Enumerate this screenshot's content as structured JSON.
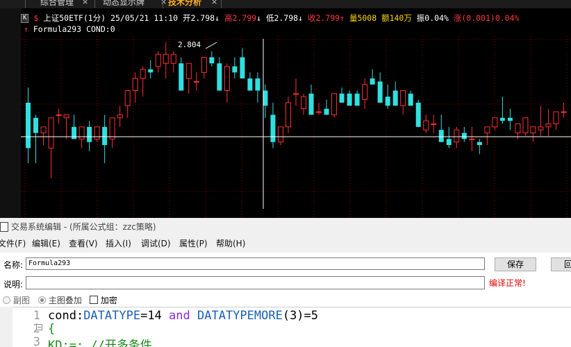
{
  "tabs": [
    {
      "label": "综合管理"
    },
    {
      "label": "动态显示牌"
    },
    {
      "label": "技术分析"
    }
  ],
  "quote_header": {
    "k_badge": "K",
    "dollar": "$",
    "symbol": "上证50ETF(1分)",
    "datetime": "25/05/21 11:10",
    "open_label": "开",
    "open_value": "2.798",
    "high_label": "高",
    "high_value": "2.799",
    "low_label": "低",
    "low_value": "2.798",
    "close_label": "收",
    "close_value": "2.799",
    "volume_label": "量",
    "volume_value": "5008",
    "amount_label": "额",
    "amount_value": "140万",
    "amplitude_label": "振",
    "amplitude_value": "0.04%",
    "change_label": "涨",
    "change_value": "(0.001)",
    "change_pct": "0.04%"
  },
  "formula_header": {
    "name": "Formula293",
    "cond_label": "COND:",
    "cond_value": "0"
  },
  "chart_annotation": "2.804",
  "chart_data": {
    "type": "candlestick",
    "title": "上证50ETF(1分)",
    "colors": {
      "up": "#ff3030",
      "down": "#30e0e0",
      "crosshair": "#ffffff",
      "grid": "#8b0000"
    },
    "candles": [
      {
        "o": 2.797,
        "h": 2.7975,
        "l": 2.795,
        "c": 2.7955
      },
      {
        "o": 2.7965,
        "h": 2.7966,
        "l": 2.795,
        "c": 2.796
      },
      {
        "o": 2.796,
        "h": 2.7962,
        "l": 2.7956,
        "c": 2.7962
      },
      {
        "o": 2.7955,
        "h": 2.7965,
        "l": 2.7945,
        "c": 2.7965
      },
      {
        "o": 2.7966,
        "h": 2.7968,
        "l": 2.7963,
        "c": 2.7966
      },
      {
        "o": 2.7965,
        "h": 2.7966,
        "l": 2.7958,
        "c": 2.7966
      },
      {
        "o": 2.7962,
        "h": 2.7966,
        "l": 2.7958,
        "c": 2.7958
      },
      {
        "o": 2.7958,
        "h": 2.7962,
        "l": 2.7955,
        "c": 2.7962
      },
      {
        "o": 2.7962,
        "h": 2.7964,
        "l": 2.7954,
        "c": 2.7957
      },
      {
        "o": 2.7958,
        "h": 2.7962,
        "l": 2.7957,
        "c": 2.7962
      },
      {
        "o": 2.7962,
        "h": 2.7966,
        "l": 2.795,
        "c": 2.7956
      },
      {
        "o": 2.7958,
        "h": 2.7965,
        "l": 2.7955,
        "c": 2.7965
      },
      {
        "o": 2.7965,
        "h": 2.7969,
        "l": 2.7962,
        "c": 2.7966
      },
      {
        "o": 2.7969,
        "h": 2.7974,
        "l": 2.7965,
        "c": 2.7974
      },
      {
        "o": 2.7974,
        "h": 2.798,
        "l": 2.797,
        "c": 2.7978
      },
      {
        "o": 2.7978,
        "h": 2.7982,
        "l": 2.7972,
        "c": 2.7981
      },
      {
        "o": 2.7981,
        "h": 2.7984,
        "l": 2.7978,
        "c": 2.798
      },
      {
        "o": 2.7982,
        "h": 2.7987,
        "l": 2.798,
        "c": 2.7986
      },
      {
        "o": 2.7983,
        "h": 2.799,
        "l": 2.7978,
        "c": 2.7986
      },
      {
        "o": 2.7983,
        "h": 2.7987,
        "l": 2.798,
        "c": 2.7986
      },
      {
        "o": 2.7983,
        "h": 2.7985,
        "l": 2.7974,
        "c": 2.7974
      },
      {
        "o": 2.7978,
        "h": 2.7983,
        "l": 2.7973,
        "c": 2.7983
      },
      {
        "o": 2.7977,
        "h": 2.798,
        "l": 2.7974,
        "c": 2.7977
      },
      {
        "o": 2.798,
        "h": 2.7985,
        "l": 2.7978,
        "c": 2.7985
      },
      {
        "o": 2.7985,
        "h": 2.7987,
        "l": 2.7982,
        "c": 2.7983
      },
      {
        "o": 2.7983,
        "h": 2.7985,
        "l": 2.7974,
        "c": 2.7974
      },
      {
        "o": 2.7974,
        "h": 2.7983,
        "l": 2.797,
        "c": 2.7982
      },
      {
        "o": 2.7982,
        "h": 2.7985,
        "l": 2.7978,
        "c": 2.798
      },
      {
        "o": 2.7985,
        "h": 2.7988,
        "l": 2.7978,
        "c": 2.7978
      },
      {
        "o": 2.7978,
        "h": 2.798,
        "l": 2.7974,
        "c": 2.7974
      },
      {
        "o": 2.7978,
        "h": 2.798,
        "l": 2.797,
        "c": 2.7974
      },
      {
        "o": 2.7974,
        "h": 2.7976,
        "l": 2.7965,
        "c": 2.7969
      },
      {
        "o": 2.7966,
        "h": 2.797,
        "l": 2.7955,
        "c": 2.7957
      },
      {
        "o": 2.7957,
        "h": 2.7962,
        "l": 2.7956,
        "c": 2.7962
      },
      {
        "o": 2.7962,
        "h": 2.7972,
        "l": 2.796,
        "c": 2.797
      },
      {
        "o": 2.7973,
        "h": 2.7978,
        "l": 2.7969,
        "c": 2.7973
      },
      {
        "o": 2.7968,
        "h": 2.7973,
        "l": 2.7966,
        "c": 2.7972
      },
      {
        "o": 2.7973,
        "h": 2.7976,
        "l": 2.7966,
        "c": 2.7966
      },
      {
        "o": 2.7967,
        "h": 2.797,
        "l": 2.7966,
        "c": 2.7967
      },
      {
        "o": 2.7968,
        "h": 2.7971,
        "l": 2.7966,
        "c": 2.7966
      },
      {
        "o": 2.7966,
        "h": 2.7973,
        "l": 2.7965,
        "c": 2.7973
      },
      {
        "o": 2.7973,
        "h": 2.7975,
        "l": 2.797,
        "c": 2.797
      },
      {
        "o": 2.7973,
        "h": 2.7974,
        "l": 2.7969,
        "c": 2.7969
      },
      {
        "o": 2.7973,
        "h": 2.7974,
        "l": 2.7969,
        "c": 2.7969
      },
      {
        "o": 2.7971,
        "h": 2.7978,
        "l": 2.7968,
        "c": 2.7976
      },
      {
        "o": 2.7978,
        "h": 2.7981,
        "l": 2.7976,
        "c": 2.7976
      },
      {
        "o": 2.7977,
        "h": 2.798,
        "l": 2.797,
        "c": 2.797
      },
      {
        "o": 2.7972,
        "h": 2.7976,
        "l": 2.7968,
        "c": 2.7969
      },
      {
        "o": 2.7974,
        "h": 2.7977,
        "l": 2.7969,
        "c": 2.7969
      },
      {
        "o": 2.7969,
        "h": 2.7974,
        "l": 2.7966,
        "c": 2.7974
      },
      {
        "o": 2.7973,
        "h": 2.7974,
        "l": 2.7969,
        "c": 2.7969
      },
      {
        "o": 2.797,
        "h": 2.7971,
        "l": 2.7962,
        "c": 2.7962
      },
      {
        "o": 2.7961,
        "h": 2.7966,
        "l": 2.796,
        "c": 2.7964
      },
      {
        "o": 2.7963,
        "h": 2.7966,
        "l": 2.796,
        "c": 2.7963
      },
      {
        "o": 2.7961,
        "h": 2.7966,
        "l": 2.7957,
        "c": 2.7957
      },
      {
        "o": 2.7958,
        "h": 2.7962,
        "l": 2.7955,
        "c": 2.7956
      },
      {
        "o": 2.7957,
        "h": 2.7962,
        "l": 2.7955,
        "c": 2.7961
      },
      {
        "o": 2.796,
        "h": 2.7962,
        "l": 2.7957,
        "c": 2.7958
      },
      {
        "o": 2.7958,
        "h": 2.7962,
        "l": 2.7954,
        "c": 2.7958
      },
      {
        "o": 2.7957,
        "h": 2.7958,
        "l": 2.7953,
        "c": 2.7956
      },
      {
        "o": 2.796,
        "h": 2.7962,
        "l": 2.7956,
        "c": 2.7962
      },
      {
        "o": 2.7962,
        "h": 2.7965,
        "l": 2.7961,
        "c": 2.7965
      },
      {
        "o": 2.7965,
        "h": 2.7972,
        "l": 2.7963,
        "c": 2.7964
      },
      {
        "o": 2.7965,
        "h": 2.7968,
        "l": 2.7961,
        "c": 2.7964
      },
      {
        "o": 2.796,
        "h": 2.7963,
        "l": 2.7958,
        "c": 2.7963
      },
      {
        "o": 2.796,
        "h": 2.7965,
        "l": 2.7959,
        "c": 2.7965
      },
      {
        "o": 2.796,
        "h": 2.7962,
        "l": 2.7957,
        "c": 2.7962
      },
      {
        "o": 2.7961,
        "h": 2.7969,
        "l": 2.7959,
        "c": 2.7962
      },
      {
        "o": 2.7962,
        "h": 2.7968,
        "l": 2.7959,
        "c": 2.7963
      },
      {
        "o": 2.7963,
        "h": 2.7967,
        "l": 2.7961,
        "c": 2.7967
      },
      {
        "o": 2.7967,
        "h": 2.797,
        "l": 2.7965,
        "c": 2.7967
      }
    ]
  },
  "editor": {
    "window_title": "交易系统编辑 - (所属公式组：zzc策略)",
    "menu": [
      "文件(F)",
      "编辑(E)",
      "查看(V)",
      "插入(I)",
      "调试(D)",
      "属性(P)",
      "帮助(H)"
    ],
    "name_label": "名称:",
    "name_value": "Formula293",
    "desc_label": "说明:",
    "desc_value": "",
    "save_label": "保存",
    "return_label": "回",
    "compile_status": "编译正常!",
    "opt_sub": "副图",
    "opt_main": "主图叠加",
    "opt_encrypt": "加密",
    "code_lines": [
      {
        "num": "1",
        "parts": [
          {
            "t": "cond:",
            "c": "#000"
          },
          {
            "t": "DATATYPE",
            "c": "#1a5fb4"
          },
          {
            "t": "=14 ",
            "c": "#000"
          },
          {
            "t": "and",
            "c": "#8a2be2"
          },
          {
            "t": " ",
            "c": "#000"
          },
          {
            "t": "DATATYPEMORE",
            "c": "#1a5fb4"
          },
          {
            "t": "(3)=5",
            "c": "#000"
          }
        ]
      },
      {
        "num": "2",
        "parts": [
          {
            "t": "{",
            "c": "#1a8a1a"
          }
        ]
      },
      {
        "num": "3",
        "parts": [
          {
            "t": "KD:=;          //开多条件",
            "c": "#1a8a1a"
          }
        ]
      }
    ]
  }
}
